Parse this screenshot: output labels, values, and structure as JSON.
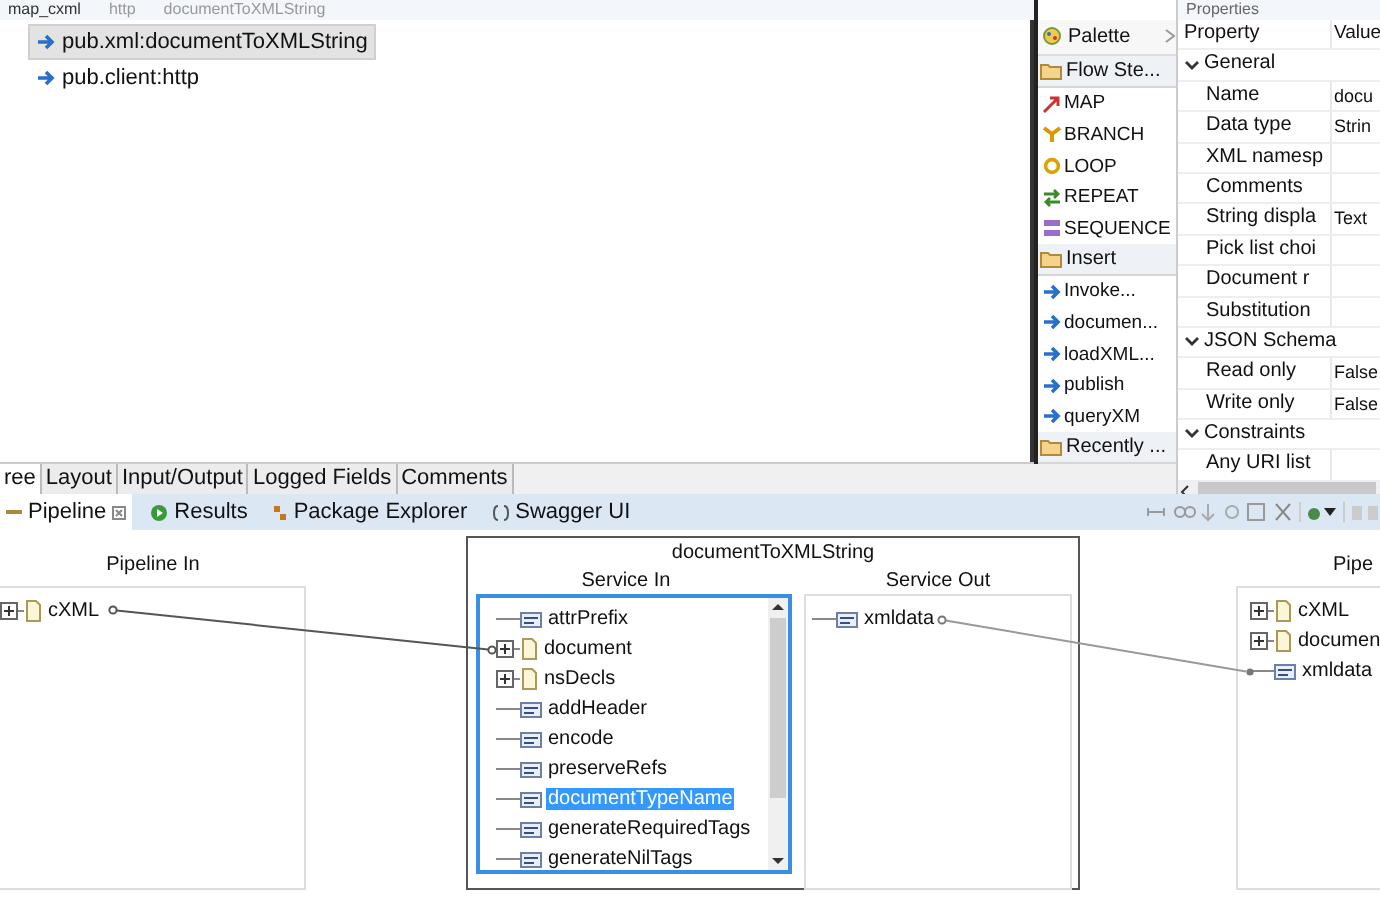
{
  "editor_tabs": [
    {
      "label": "map_cxml",
      "selected": true
    },
    {
      "label": "http",
      "selected": false
    },
    {
      "label": "documentToXMLString",
      "selected": false
    }
  ],
  "flow_steps": [
    {
      "label": "pub.xml:documentToXMLString",
      "selected": true
    },
    {
      "label": "pub.client:http",
      "selected": false
    }
  ],
  "view_tabs": [
    {
      "label": "ree",
      "selected": true
    },
    {
      "label": "Layout",
      "selected": false
    },
    {
      "label": "Input/Output",
      "selected": false
    },
    {
      "label": "Logged Fields",
      "selected": false
    },
    {
      "label": "Comments",
      "selected": false
    }
  ],
  "palette": {
    "title": "Palette",
    "sections": [
      {
        "label": "Flow Ste...",
        "items": [
          {
            "label": "MAP",
            "kind": "map"
          },
          {
            "label": "BRANCH",
            "kind": "branch"
          },
          {
            "label": "LOOP",
            "kind": "loop"
          },
          {
            "label": "REPEAT",
            "kind": "repeat"
          },
          {
            "label": "SEQUENCE",
            "kind": "sequence"
          }
        ]
      },
      {
        "label": "Insert",
        "items": [
          {
            "label": "Invoke...",
            "kind": "invoke"
          },
          {
            "label": "documen...",
            "kind": "invoke"
          },
          {
            "label": "loadXML...",
            "kind": "invoke"
          },
          {
            "label": "publish",
            "kind": "invoke"
          },
          {
            "label": "queryXM",
            "kind": "invoke"
          }
        ]
      },
      {
        "label": "Recently ..."
      }
    ]
  },
  "properties": {
    "title": "Properties",
    "columns": [
      "Property",
      "Value"
    ],
    "groups": [
      {
        "label": "General",
        "expanded": true,
        "rows": [
          {
            "name": "Name",
            "value": "docu"
          },
          {
            "name": "Data type",
            "value": "Strin"
          },
          {
            "name": "XML namesp"
          },
          {
            "name": "Comments"
          },
          {
            "name": "String displa",
            "value": "Text"
          },
          {
            "name": "Pick list choi"
          },
          {
            "name": "Document r"
          },
          {
            "name": "Substitution"
          }
        ]
      },
      {
        "label": "JSON Schema",
        "expanded": true,
        "rows": [
          {
            "name": "Read only",
            "value": "False"
          },
          {
            "name": "Write only",
            "value": "False"
          }
        ]
      },
      {
        "label": "Constraints",
        "expanded": true,
        "rows": [
          {
            "name": "Any URI list"
          }
        ]
      }
    ]
  },
  "pipeline_tabs": [
    {
      "label": "Pipeline",
      "selected": true
    },
    {
      "label": "Results",
      "selected": false
    },
    {
      "label": "Package Explorer",
      "selected": false
    },
    {
      "label": "Swagger UI",
      "selected": false
    }
  ],
  "pipeline_in": {
    "title": "Pipeline In",
    "items": [
      {
        "label": "cXML",
        "kind": "document",
        "expandable": true
      }
    ]
  },
  "service": {
    "title": "documentToXMLString",
    "in_title": "Service In",
    "inputs": [
      {
        "label": "attrPrefix",
        "kind": "string",
        "expandable": false,
        "selected": false
      },
      {
        "label": "document",
        "kind": "document",
        "expandable": true,
        "selected": false
      },
      {
        "label": "nsDecls",
        "kind": "document",
        "expandable": true,
        "selected": false
      },
      {
        "label": "addHeader",
        "kind": "string",
        "expandable": false,
        "selected": false
      },
      {
        "label": "encode",
        "kind": "string",
        "expandable": false,
        "selected": false
      },
      {
        "label": "preserveRefs",
        "kind": "string",
        "expandable": false,
        "selected": false
      },
      {
        "label": "documentTypeName",
        "kind": "string",
        "expandable": false,
        "selected": true
      },
      {
        "label": "generateRequiredTags",
        "kind": "string",
        "expandable": false,
        "selected": false
      },
      {
        "label": "generateNilTags",
        "kind": "string",
        "expandable": false,
        "selected": false
      }
    ],
    "out_title": "Service Out",
    "outputs": [
      {
        "label": "xmldata",
        "kind": "string",
        "expandable": false
      }
    ]
  },
  "pipeline_out": {
    "title": "Pipe",
    "items": [
      {
        "label": "cXML",
        "kind": "document",
        "expandable": true
      },
      {
        "label": "documen",
        "kind": "document",
        "expandable": true
      },
      {
        "label": "xmldata",
        "kind": "string",
        "expandable": false
      }
    ]
  }
}
